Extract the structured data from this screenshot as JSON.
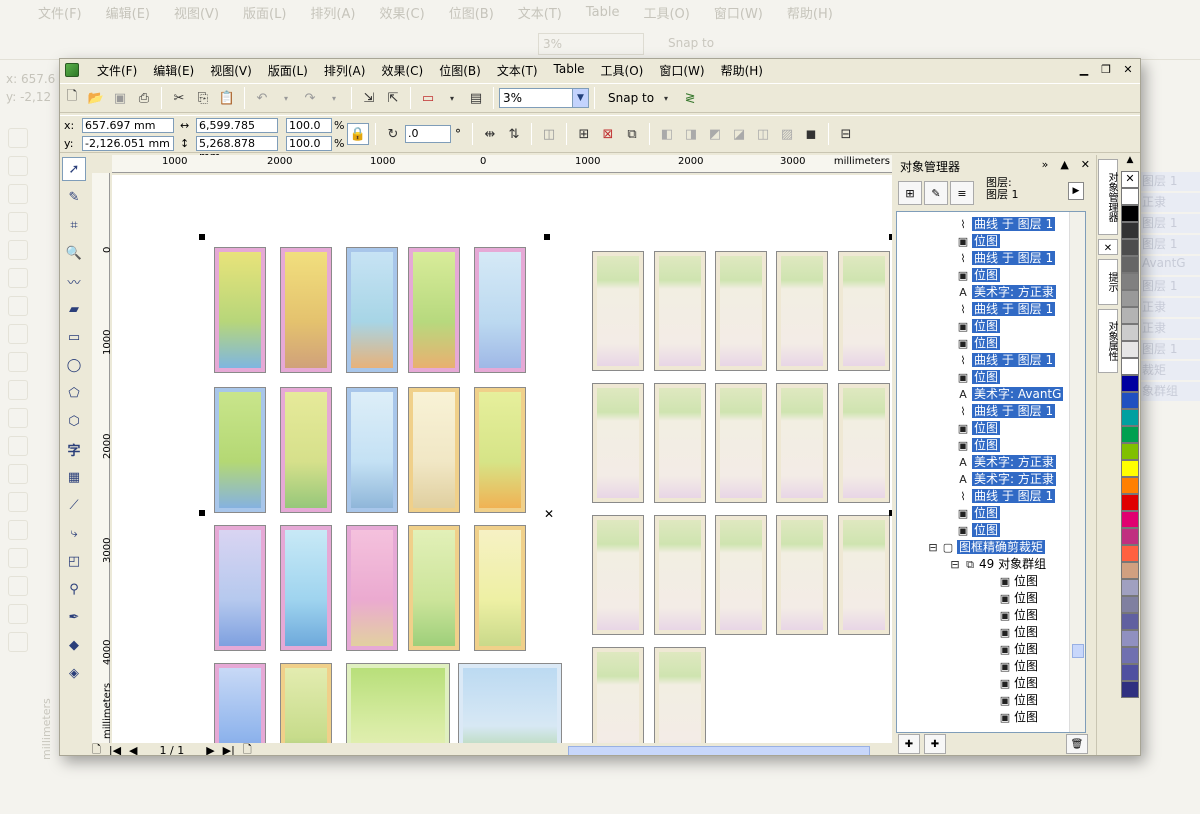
{
  "ghost": {
    "menus": [
      "文件(F)",
      "编辑(E)",
      "视图(V)",
      "版面(L)",
      "排列(A)",
      "效果(C)",
      "位图(B)",
      "文本(T)",
      "Table",
      "工具(O)",
      "窗口(W)",
      "帮助(H)"
    ],
    "zoom": "3%",
    "snap": "Snap to",
    "coord_x": "x: 657.6",
    "coord_y": "y: -2,12",
    "ruler_label": "millimeters",
    "right_items": [
      "图层 1",
      "正隶",
      "图层 1",
      "图层 1",
      "AvantG",
      "图层 1",
      "正隶",
      "正隶",
      "图层 1",
      "裁矩",
      "象群组"
    ]
  },
  "menu": {
    "items": [
      "文件(F)",
      "编辑(E)",
      "视图(V)",
      "版面(L)",
      "排列(A)",
      "效果(C)",
      "位图(B)",
      "文本(T)",
      "Table",
      "工具(O)",
      "窗口(W)",
      "帮助(H)"
    ]
  },
  "toolbar": {
    "zoom": "3%",
    "snap": "Snap to"
  },
  "property_bar": {
    "x_label": "x:",
    "y_label": "y:",
    "x_value": "657.697 mm",
    "y_value": "-2,126.051 mm",
    "w_value": "6,599.785 mm",
    "h_value": "5,268.878 mm",
    "scale_x": "100.0",
    "scale_y": "100.0",
    "pct": "%",
    "rotation": ".0",
    "deg": "°"
  },
  "ruler": {
    "h_ticks": [
      "1000",
      "2000",
      "1000",
      "0",
      "1000",
      "2000",
      "3000"
    ],
    "unit": "millimeters",
    "v_ticks": [
      "0",
      "1000",
      "2000",
      "3000",
      "4000"
    ],
    "v_unit": "millimeters"
  },
  "status": {
    "page": "1 / 1"
  },
  "docker": {
    "title": "对象管理器",
    "layer_label": "图层:",
    "layer_name": "图层 1",
    "rows": [
      {
        "icon": "curve",
        "text": "曲线 于 图层 1",
        "selected": true
      },
      {
        "icon": "bitmap",
        "text": "位图",
        "selected": true
      },
      {
        "icon": "curve",
        "text": "曲线 于 图层 1",
        "selected": true
      },
      {
        "icon": "bitmap",
        "text": "位图",
        "selected": true
      },
      {
        "icon": "text",
        "text": "美术字: 方正隶",
        "selected": true
      },
      {
        "icon": "curve",
        "text": "曲线 于 图层 1",
        "selected": true
      },
      {
        "icon": "bitmap",
        "text": "位图",
        "selected": true
      },
      {
        "icon": "bitmap",
        "text": "位图",
        "selected": true
      },
      {
        "icon": "curve",
        "text": "曲线 于 图层 1",
        "selected": true
      },
      {
        "icon": "bitmap",
        "text": "位图",
        "selected": true
      },
      {
        "icon": "text",
        "text": "美术字: AvantG",
        "selected": true
      },
      {
        "icon": "curve",
        "text": "曲线 于 图层 1",
        "selected": true
      },
      {
        "icon": "bitmap",
        "text": "位图",
        "selected": true
      },
      {
        "icon": "bitmap",
        "text": "位图",
        "selected": true
      },
      {
        "icon": "text",
        "text": "美术字: 方正隶",
        "selected": true
      },
      {
        "icon": "text",
        "text": "美术字: 方正隶",
        "selected": true
      },
      {
        "icon": "curve",
        "text": "曲线 于 图层 1",
        "selected": true
      },
      {
        "icon": "bitmap",
        "text": "位图",
        "selected": true
      },
      {
        "icon": "bitmap",
        "text": "位图",
        "selected": true
      },
      {
        "icon": "frame",
        "text": "图框精确剪裁矩",
        "selected": true,
        "indent": 0,
        "expander": "−"
      },
      {
        "icon": "group",
        "text": "49 对象群组",
        "selected": false,
        "indent": 1,
        "expander": "−"
      },
      {
        "icon": "bitmap",
        "text": "位图",
        "selected": false,
        "indent": 2
      },
      {
        "icon": "bitmap",
        "text": "位图",
        "selected": false,
        "indent": 2
      },
      {
        "icon": "bitmap",
        "text": "位图",
        "selected": false,
        "indent": 2
      },
      {
        "icon": "bitmap",
        "text": "位图",
        "selected": false,
        "indent": 2
      },
      {
        "icon": "bitmap",
        "text": "位图",
        "selected": false,
        "indent": 2
      },
      {
        "icon": "bitmap",
        "text": "位图",
        "selected": false,
        "indent": 2
      },
      {
        "icon": "bitmap",
        "text": "位图",
        "selected": false,
        "indent": 2
      },
      {
        "icon": "bitmap",
        "text": "位图",
        "selected": false,
        "indent": 2
      },
      {
        "icon": "bitmap",
        "text": "位图",
        "selected": false,
        "indent": 2
      }
    ]
  },
  "side_tabs": [
    "对象管理器",
    "提示",
    "对象属性"
  ],
  "palette": [
    "#ffffff",
    "#000000",
    "#333333",
    "#4d4d4d",
    "#666666",
    "#808080",
    "#999999",
    "#b3b3b3",
    "#cccccc",
    "#e6e6e6",
    "#ffffff",
    "#0000a0",
    "#2050c0",
    "#00a0a0",
    "#00a050",
    "#80c000",
    "#ffff00",
    "#ff8000",
    "#e00000",
    "#e00070",
    "#c03080",
    "#ff6040",
    "#d0a080",
    "#a0a0c0",
    "#8080a0",
    "#6060a0",
    "#9090c0",
    "#7070b0",
    "#5050a0",
    "#303080"
  ]
}
